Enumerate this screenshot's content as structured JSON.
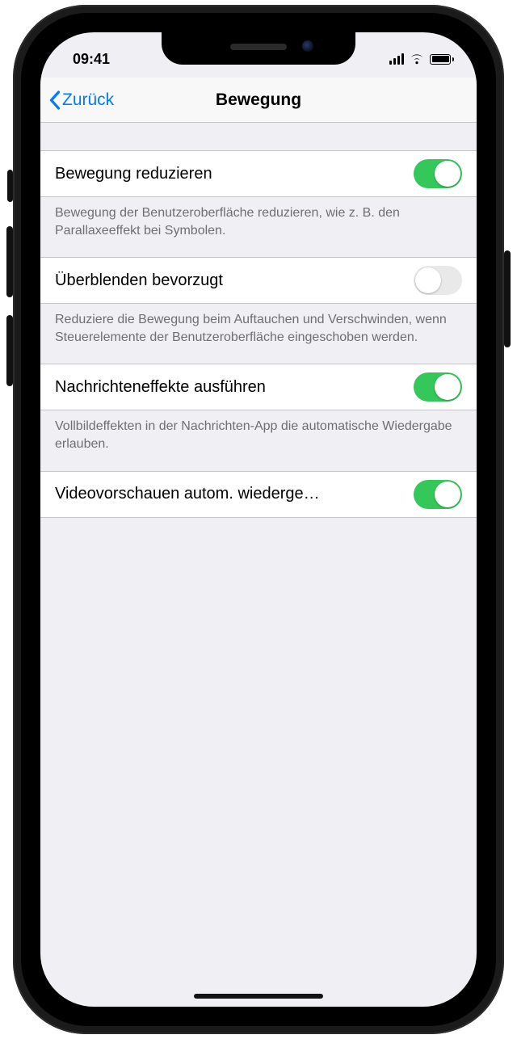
{
  "status": {
    "time": "09:41"
  },
  "nav": {
    "back_label": "Zurück",
    "title": "Bewegung"
  },
  "settings": [
    {
      "id": "reduce_motion",
      "label": "Bewegung reduzieren",
      "value": true,
      "footer": "Bewegung der Benutzeroberfläche reduzieren, wie z. B. den Parallaxeeffekt bei Symbolen."
    },
    {
      "id": "prefer_crossfade",
      "label": "Überblenden bevorzugt",
      "value": false,
      "footer": "Reduziere die Bewegung beim Auftauchen und Verschwinden, wenn Steuerelemente der Benutzeroberfläche eingeschoben werden."
    },
    {
      "id": "message_effects",
      "label": "Nachrichteneffekte ausführen",
      "value": true,
      "footer": "Vollbildeffekten in der Nachrichten-App die automatische Wiedergabe erlauben."
    },
    {
      "id": "video_previews",
      "label": "Videovorschauen autom. wiederge…",
      "value": true,
      "footer": ""
    }
  ]
}
